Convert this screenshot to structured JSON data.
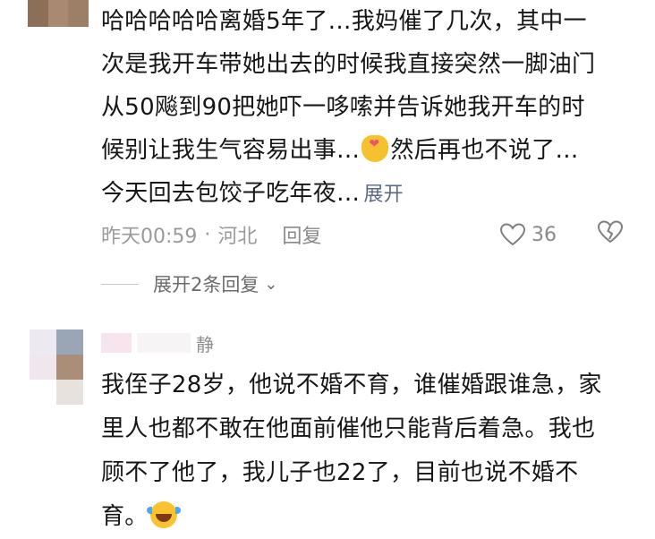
{
  "comment1": {
    "lines": [
      "哈哈哈哈哈离婚5年了…我妈催了几次，其中一",
      "次是我开车带她出去的时候我直接突然一脚油门",
      "从50飚到90把她吓一哆嗦并告诉她我开车的时",
      "候别让我生气容易出事…",
      "然后再也不说了…",
      "今天回去包饺子吃年夜…"
    ],
    "expand_label": "展开",
    "meta": {
      "time": "昨天00:59",
      "separator": "·",
      "location": "河北",
      "reply_label": "回复",
      "like_count": "36"
    },
    "replies_toggle": "展开2条回复"
  },
  "comment2": {
    "username": "静",
    "lines": [
      "我侄子28岁，他说不婚不育，谁催婚跟谁急，家",
      "里人也都不敢在他面前催他只能背后着急。我也",
      "顾不了他了，我儿子也22了，目前也说不婚不",
      "育。"
    ]
  },
  "icons": {
    "like": "heart-outline-icon",
    "dislike": "broken-heart-icon",
    "chevron": "chevron-down-icon",
    "emoji1": "finger-heart-emoji",
    "emoji2": "laughing-crying-emoji"
  },
  "colors": {
    "text": "#161616",
    "meta": "#9a9a9a",
    "link": "#5b6a82"
  }
}
